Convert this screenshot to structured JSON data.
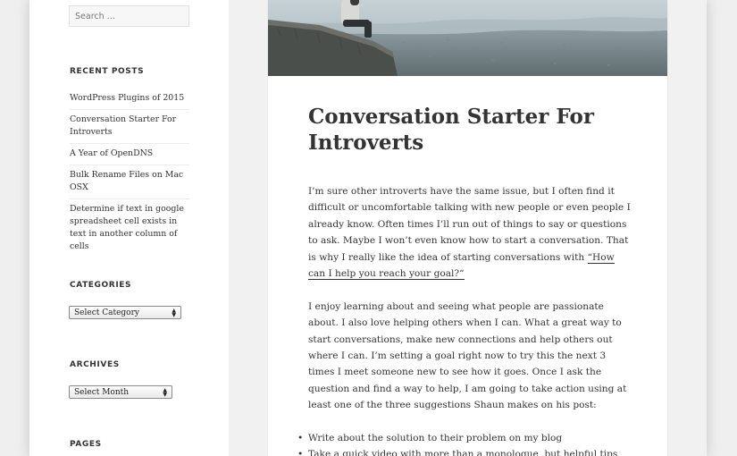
{
  "sidebar": {
    "search_placeholder": "Search …",
    "recent_posts": {
      "title": "RECENT POSTS",
      "items": [
        "WordPress Plugins of 2015",
        "Conversation Starter For Introverts",
        "A Year of OpenDNS",
        "Bulk Rename Files on Mac OSX",
        "Determine if text in google spreadsheet cell exists in text in another column of cells"
      ]
    },
    "categories": {
      "title": "CATEGORIES",
      "select_value": "Select Category"
    },
    "archives": {
      "title": "ARCHIVES",
      "select_value": "Select Month"
    },
    "pages": {
      "title": "PAGES"
    }
  },
  "post": {
    "title": "Conversation Starter For Introverts",
    "paragraph1_before_link": "I’m sure other introverts have the same issue, but I often find it difficult or uncomfortable talking with new people or even people I already know. Often times I’ll run out of things to say or questions to ask. Maybe I won’t even know how to start a conversation. That is why I really like the idea of starting conversations with ",
    "paragraph1_link": "“How can I help you reach your goal?“",
    "paragraph2": "I enjoy learning about and seeing what people are passionate about. I also love helping others when I can. What a great way to start conversations, make new connections and help others out where I can. I’m setting a goal right now to try this the next 3 times I meet someone new to see how it goes. Once I ask the question and find a way to help, I am going to take action using at least one of the three suggestions Shaun makes on his post:",
    "bullets": [
      "Write about the solution to their problem on my blog",
      "Take a quick video with more than a monologue, but helpful tips"
    ]
  },
  "colors": {
    "page_background": "#efefef",
    "sidebar_background": "#ffffff",
    "text": "#333333"
  }
}
